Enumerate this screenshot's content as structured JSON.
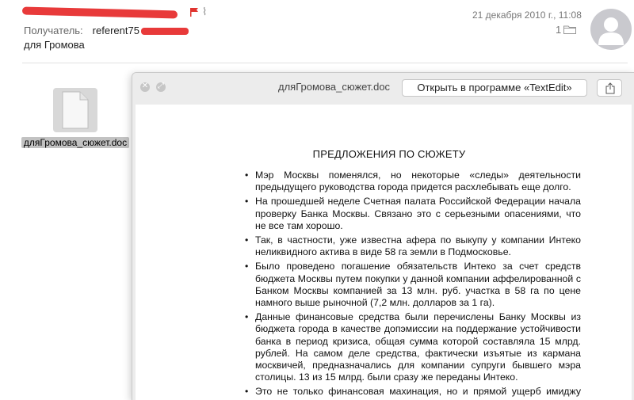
{
  "message": {
    "recipient_label": "Получатель:",
    "recipient_value": "referent75",
    "subject": "для Громова",
    "date": "21 декабря 2010 г., 11:08",
    "attachment_count": "1"
  },
  "attachment": {
    "filename": "дляГромова_сюжет.doc"
  },
  "quicklook": {
    "title": "дляГромова_сюжет.doc",
    "open_button_label": "Открыть в программе «TextEdit»"
  },
  "document": {
    "heading": "ПРЕДЛОЖЕНИЯ ПО СЮЖЕТУ",
    "bullets": [
      "Мэр Москвы поменялся, но некоторые «следы» деятельности предыдущего руководства города придется расхлебывать еще долго.",
      "На прошедшей неделе Счетная палата Российской Федерации начала проверку Банка Москвы. Связано это с серьезными опасениями, что не все там хорошо.",
      "Так, в частности, уже известна афера по выкупу у компании Интеко неликвидного актива в виде 58 га земли в Подмосковье.",
      "Было проведено погашение обязательств Интеко за счет средств бюджета Москвы путем покупки у данной компании аффелированной с Банком Москвы компанией за 13 млн. руб. участка в 58 га по цене намного выше рыночной (7,2 млн. долларов за 1 га).",
      "Данные финансовые средства были перечислены Банку Москвы из бюджета города в качестве допэмиссии на поддержание устойчивости банка в период кризиса, общая сумма которой составляла 15 млрд. рублей. На самом деле средства, фактически изъятые из кармана москвичей, предназначались для компании супруги бывшего мэра столицы. 13 из 15 млрд. были сразу же переданы Интеко.",
      "Это не только финансовая махинация, но и прямой ущерб имиджу России на международной арене, т.к. земли изначально"
    ]
  },
  "icons": {
    "flag": "flag-icon",
    "attachment": "paperclip-icon",
    "folder": "folder-icon",
    "avatar": "avatar-icon",
    "close": "close-icon",
    "fullscreen": "fullscreen-icon",
    "share": "share-icon",
    "document": "document-icon"
  },
  "colors": {
    "redaction": "#e83a3a",
    "flag": "#e0342f"
  }
}
